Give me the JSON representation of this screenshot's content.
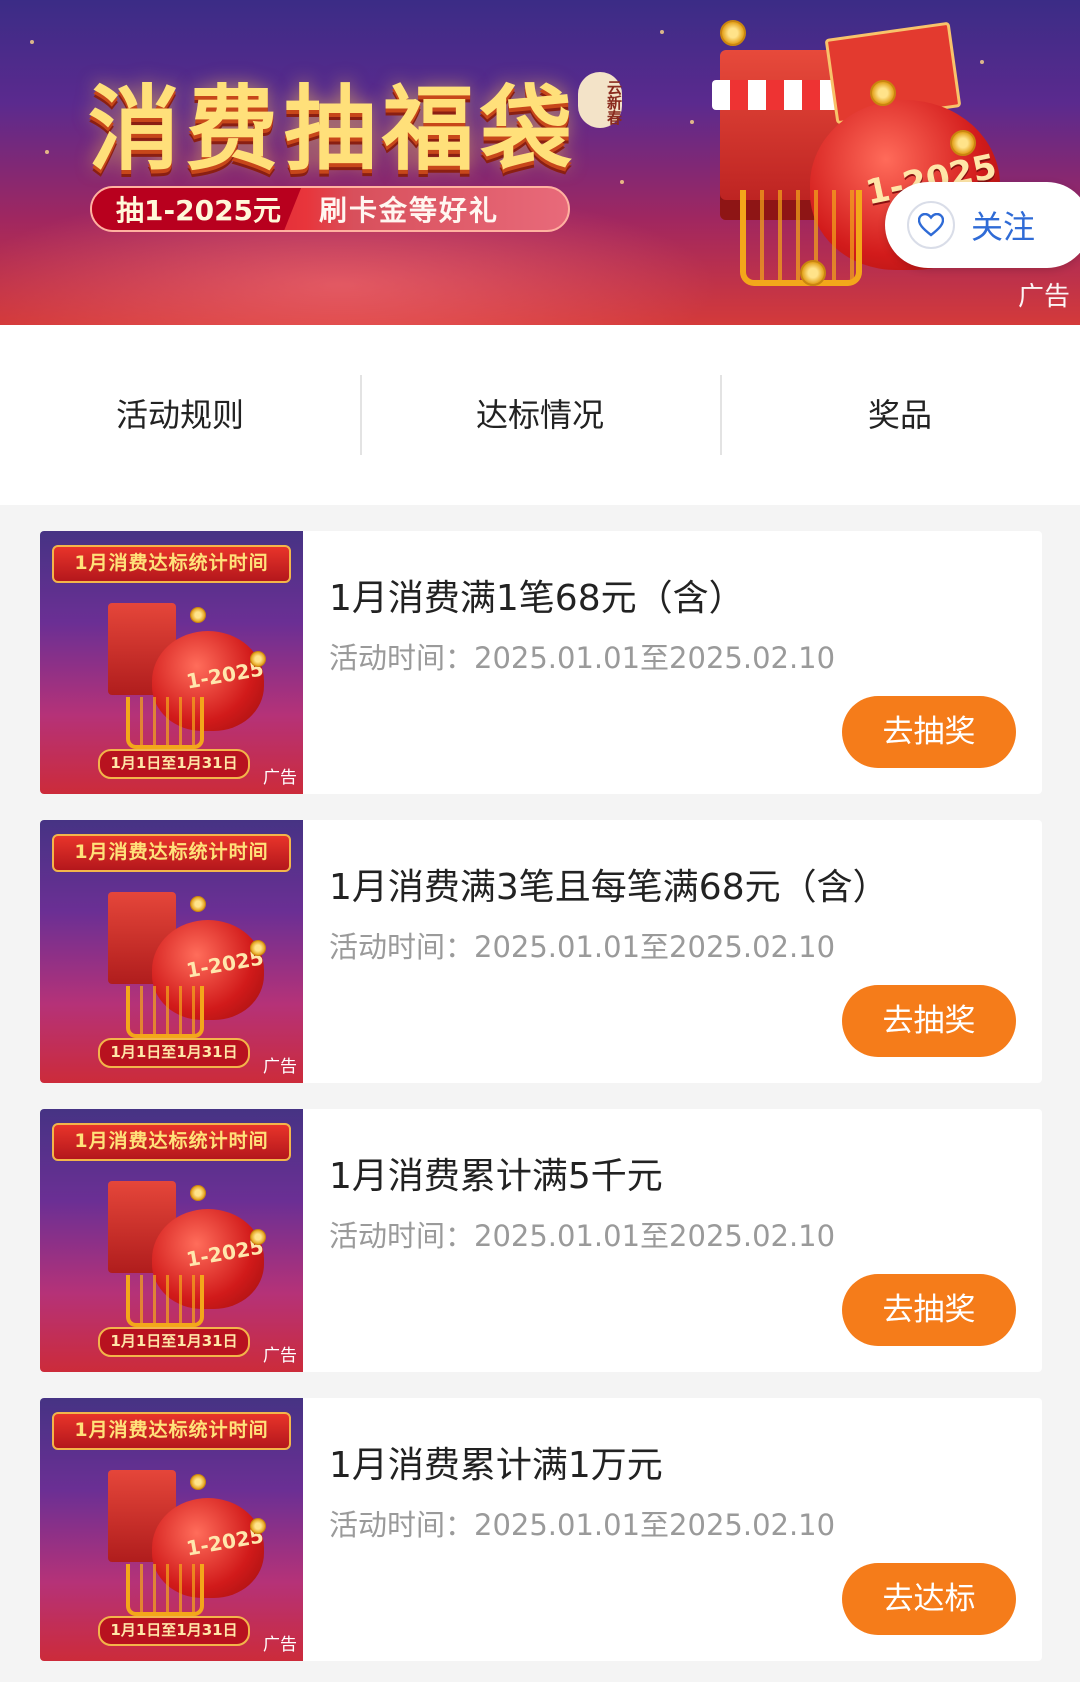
{
  "banner": {
    "title": "消费抽福袋",
    "seal": "云新春",
    "pill_left": "抽1-2025元",
    "pill_right": "刷卡金等好礼",
    "bag_text": "1-2025",
    "follow_label": "关注",
    "ad_tag": "广告",
    "colors": {
      "follow": "#2f6bd6",
      "accent": "#f57c1a"
    }
  },
  "tabs": [
    {
      "label": "活动规则"
    },
    {
      "label": "达标情况"
    },
    {
      "label": "奖品"
    }
  ],
  "thumb": {
    "top_text": "1月消费达标统计时间",
    "bag_text": "1-2025",
    "date_text": "1月1日至1月31日",
    "ad_tag": "广告"
  },
  "cards": [
    {
      "title": "1月消费满1笔68元（含）",
      "time": "活动时间：2025.01.01至2025.02.10",
      "button": "去抽奖"
    },
    {
      "title": "1月消费满3笔且每笔满68元（含）",
      "time": "活动时间：2025.01.01至2025.02.10",
      "button": "去抽奖"
    },
    {
      "title": "1月消费累计满5千元",
      "time": "活动时间：2025.01.01至2025.02.10",
      "button": "去抽奖"
    },
    {
      "title": "1月消费累计满1万元",
      "time": "活动时间：2025.01.01至2025.02.10",
      "button": "去达标"
    }
  ]
}
